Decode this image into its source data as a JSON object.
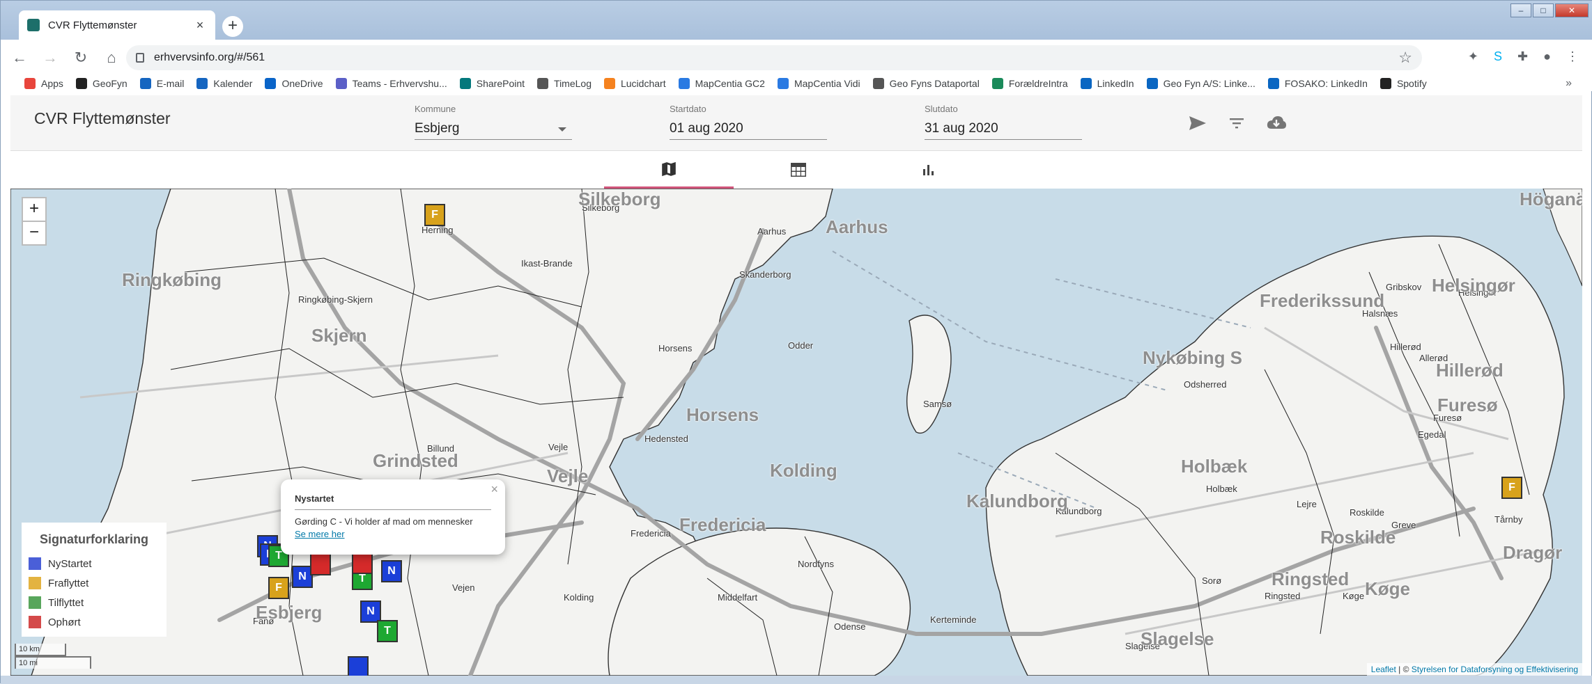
{
  "browser": {
    "tab_title": "CVR Flyttemønster",
    "tab_close": "×",
    "new_tab": "+",
    "url": "erhvervsinfo.org/#/561",
    "bookmarks": [
      {
        "label": "Apps",
        "color": "#e8453c"
      },
      {
        "label": "GeoFyn",
        "color": "#222222"
      },
      {
        "label": "E-mail",
        "color": "#1565c0"
      },
      {
        "label": "Kalender",
        "color": "#1565c0"
      },
      {
        "label": "OneDrive",
        "color": "#0a64c8"
      },
      {
        "label": "Teams - Erhvervshu...",
        "color": "#5b5fc7"
      },
      {
        "label": "SharePoint",
        "color": "#03787c"
      },
      {
        "label": "TimeLog",
        "color": "#555555"
      },
      {
        "label": "Lucidchart",
        "color": "#f5821f"
      },
      {
        "label": "MapCentia GC2",
        "color": "#2a7ae2"
      },
      {
        "label": "MapCentia Vidi",
        "color": "#2a7ae2"
      },
      {
        "label": "Geo Fyns Dataportal",
        "color": "#555555"
      },
      {
        "label": "ForældreIntra",
        "color": "#1a8a5a"
      },
      {
        "label": "LinkedIn",
        "color": "#0a66c2"
      },
      {
        "label": "Geo Fyn A/S: Linke...",
        "color": "#0a66c2"
      },
      {
        "label": "FOSAKO: LinkedIn",
        "color": "#0a66c2"
      },
      {
        "label": "Spotify",
        "color": "#222222"
      }
    ],
    "bookmarks_more": "»"
  },
  "app": {
    "title": "CVR Flyttemønster",
    "kommune": {
      "label": "Kommune",
      "value": "Esbjerg"
    },
    "startdato": {
      "label": "Startdato",
      "value": "01 aug 2020"
    },
    "slutdato": {
      "label": "Slutdato",
      "value": "31 aug 2020"
    },
    "icons": [
      "send-icon",
      "filter-icon",
      "cloud-download-icon"
    ],
    "view_tabs": [
      {
        "name": "map-icon",
        "active": true
      },
      {
        "name": "table-icon",
        "active": false
      },
      {
        "name": "bar-chart-icon",
        "active": false
      }
    ]
  },
  "map": {
    "zoom_in": "+",
    "zoom_out": "−",
    "place_labels": [
      {
        "text": "Silkeborg"
      },
      {
        "text": "Herning"
      },
      {
        "text": "Aarhus"
      },
      {
        "text": "Ikast-Brande"
      },
      {
        "text": "Skanderborg"
      },
      {
        "text": "Ringkøbing-Skjern"
      },
      {
        "text": "Horsens"
      },
      {
        "text": "Odder"
      },
      {
        "text": "Samsø"
      },
      {
        "text": "Hedensted"
      },
      {
        "text": "Billund"
      },
      {
        "text": "Vejle"
      },
      {
        "text": "Fredericia"
      },
      {
        "text": "Vejen"
      },
      {
        "text": "Kolding"
      },
      {
        "text": "Middelfart"
      },
      {
        "text": "Nordfyns"
      },
      {
        "text": "Odense"
      },
      {
        "text": "Kerteminde"
      },
      {
        "text": "Kalundborg"
      },
      {
        "text": "Holbæk"
      },
      {
        "text": "Lejre"
      },
      {
        "text": "Roskilde"
      },
      {
        "text": "Greve"
      },
      {
        "text": "Sorø"
      },
      {
        "text": "Ringsted"
      },
      {
        "text": "Køge"
      },
      {
        "text": "Slagelse"
      },
      {
        "text": "Odsherred"
      },
      {
        "text": "Gribskov"
      },
      {
        "text": "Helsingør"
      },
      {
        "text": "Halsnæs"
      },
      {
        "text": "Hillerød"
      },
      {
        "text": "Allerød"
      },
      {
        "text": "Furesø"
      },
      {
        "text": "Egedal"
      },
      {
        "text": "Tårnby"
      },
      {
        "text": "Fanø"
      }
    ],
    "big_labels": [
      {
        "text": "Aarhus"
      },
      {
        "text": "Silkeborg"
      },
      {
        "text": "Ringkøbing"
      },
      {
        "text": "Skjern"
      },
      {
        "text": "Horsens"
      },
      {
        "text": "Vejle"
      },
      {
        "text": "Grindsted"
      },
      {
        "text": "Fredericia"
      },
      {
        "text": "Kolding"
      },
      {
        "text": "Nykøbing S"
      },
      {
        "text": "Holbæk"
      },
      {
        "text": "Kalundborg"
      },
      {
        "text": "Roskilde"
      },
      {
        "text": "Ringsted"
      },
      {
        "text": "Køge"
      },
      {
        "text": "Slagelse"
      },
      {
        "text": "Frederikssund"
      },
      {
        "text": "Helsingør"
      },
      {
        "text": "Hillerød"
      },
      {
        "text": "Furesø"
      },
      {
        "text": "Esbjerg"
      },
      {
        "text": "Dragør"
      },
      {
        "text": "Höganäs"
      }
    ],
    "markers": [
      {
        "type": "F",
        "label": "F"
      },
      {
        "type": "F",
        "label": "F"
      },
      {
        "type": "N",
        "label": "N"
      },
      {
        "type": "N",
        "label": "N"
      },
      {
        "type": "N",
        "label": "N"
      },
      {
        "type": "N",
        "label": "N"
      },
      {
        "type": "T",
        "label": "T"
      },
      {
        "type": "T",
        "label": "T"
      },
      {
        "type": "F",
        "label": "F"
      },
      {
        "type": "N",
        "label": "N"
      },
      {
        "type": "T",
        "label": "T"
      },
      {
        "type": "O",
        "label": ""
      },
      {
        "type": "O",
        "label": ""
      },
      {
        "type": "N",
        "label": ""
      }
    ],
    "popup": {
      "title": "Nystartet",
      "text": "Gørding C - Vi holder af mad om mennesker",
      "link": "Se mere her",
      "close": "×"
    },
    "legend": {
      "title": "Signaturforklaring",
      "items": [
        {
          "label": "NyStartet",
          "color": "#4a5fd8"
        },
        {
          "label": "Fraflyttet",
          "color": "#e3b341"
        },
        {
          "label": "Tilflyttet",
          "color": "#59a65c"
        },
        {
          "label": "Ophørt",
          "color": "#d44a4a"
        }
      ]
    },
    "scale": {
      "km": "10 km",
      "mi": "10 mi"
    },
    "attribution": {
      "leaflet": "Leaflet",
      "sep": " | © ",
      "source": "Styrelsen for Dataforsyning og Effektivisering"
    }
  }
}
